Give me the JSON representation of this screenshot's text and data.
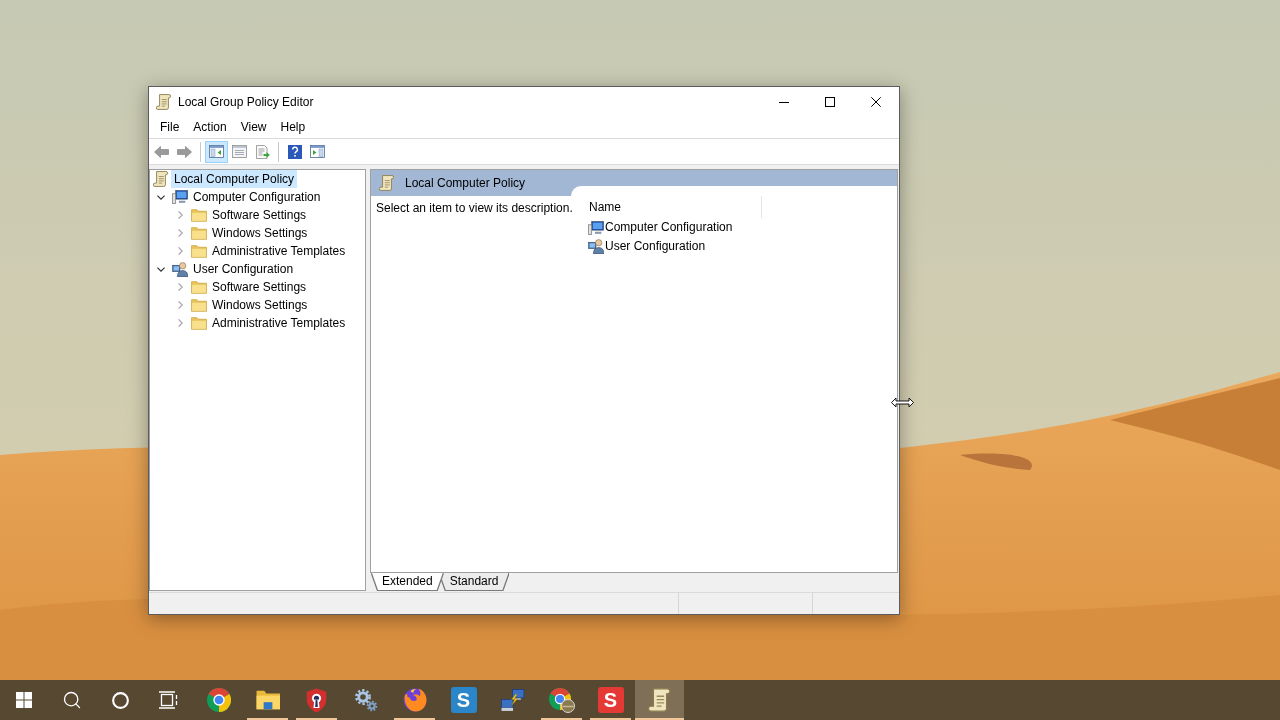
{
  "window": {
    "title": "Local Group Policy Editor"
  },
  "menu": [
    "File",
    "Action",
    "View",
    "Help"
  ],
  "toolbar": [
    [
      {
        "kind": "back",
        "disabled": true,
        "pressed": false
      },
      {
        "kind": "forward",
        "disabled": true,
        "pressed": false
      }
    ],
    [
      {
        "kind": "console_tree",
        "disabled": false,
        "pressed": true
      },
      {
        "kind": "properties",
        "disabled": false,
        "pressed": false
      },
      {
        "kind": "export_list",
        "disabled": false,
        "pressed": false
      }
    ],
    [
      {
        "kind": "help",
        "disabled": false,
        "pressed": false
      },
      {
        "kind": "action_pane",
        "disabled": false,
        "pressed": false
      }
    ]
  ],
  "tree": [
    {
      "label": "Local Computer Policy",
      "kind": "policy",
      "selected": true,
      "children": [
        {
          "label": "Computer Configuration",
          "kind": "computer",
          "selected": false,
          "expanded": true,
          "children": [
            {
              "label": "Software Settings",
              "kind": "folder",
              "selected": false,
              "expanded": false
            },
            {
              "label": "Windows Settings",
              "kind": "folder",
              "selected": false,
              "expanded": false
            },
            {
              "label": "Administrative Templates",
              "kind": "folder",
              "selected": false,
              "expanded": false
            }
          ]
        },
        {
          "label": "User Configuration",
          "kind": "user",
          "selected": false,
          "expanded": true,
          "children": [
            {
              "label": "Software Settings",
              "kind": "folder",
              "selected": false,
              "expanded": false
            },
            {
              "label": "Windows Settings",
              "kind": "folder",
              "selected": false,
              "expanded": false
            },
            {
              "label": "Administrative Templates",
              "kind": "folder",
              "selected": false,
              "expanded": false
            }
          ]
        }
      ]
    }
  ],
  "details": {
    "title": "Local Computer Policy",
    "description": "Select an item to view its description.",
    "columns": [
      "Name"
    ],
    "items": [
      {
        "label": "Computer Configuration",
        "kind": "computer"
      },
      {
        "label": "User Configuration",
        "kind": "user"
      }
    ]
  },
  "view_tabs": [
    {
      "label": "Extended",
      "selected": true
    },
    {
      "label": "Standard",
      "selected": false
    }
  ],
  "taskbar": {
    "buttons": [
      {
        "kind": "start"
      },
      {
        "kind": "search"
      },
      {
        "kind": "cortana"
      },
      {
        "kind": "task_view"
      }
    ],
    "apps": [
      {
        "kind": "browser",
        "running": false,
        "active": false
      },
      {
        "kind": "folder",
        "running": true,
        "active": false
      },
      {
        "kind": "shield",
        "running": true,
        "active": false
      },
      {
        "kind": "gears",
        "running": false,
        "active": false
      },
      {
        "kind": "fox",
        "running": true,
        "active": false
      },
      {
        "kind": "letter_tile",
        "letter": "S",
        "color": "#2a86c8",
        "running": false,
        "active": false
      },
      {
        "kind": "network",
        "running": false,
        "active": false
      },
      {
        "kind": "browser_profile",
        "running": true,
        "active": false
      },
      {
        "kind": "letter_tile",
        "letter": "S",
        "color": "#e53935",
        "running": true,
        "active": false
      },
      {
        "kind": "scroll",
        "running": true,
        "active": true
      }
    ]
  }
}
